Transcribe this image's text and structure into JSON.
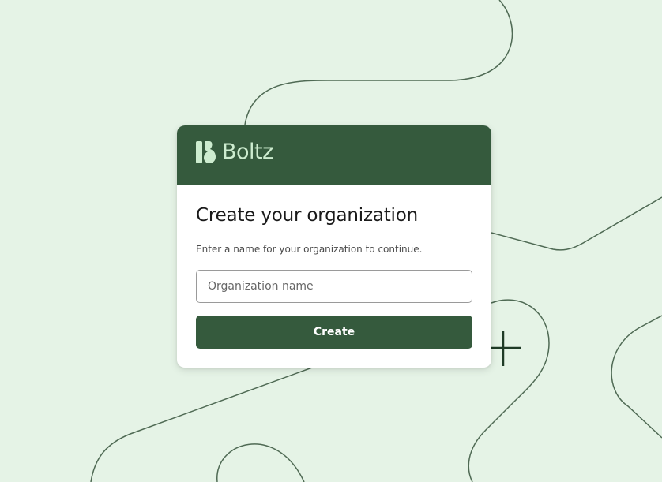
{
  "brand": {
    "name": "Boltz",
    "logo_icon": "boltz-logo-icon",
    "header_color": "#355a3d",
    "logo_text_color": "#cdeccf"
  },
  "form": {
    "title": "Create your organization",
    "subtitle": "Enter a name for your organization to continue.",
    "org_name_value": "",
    "org_name_placeholder": "Organization name",
    "submit_label": "Create"
  },
  "decorations": {
    "plus_icon": "plus-icon",
    "background_color": "#e5f3e6",
    "line_color": "#4f6a54"
  }
}
